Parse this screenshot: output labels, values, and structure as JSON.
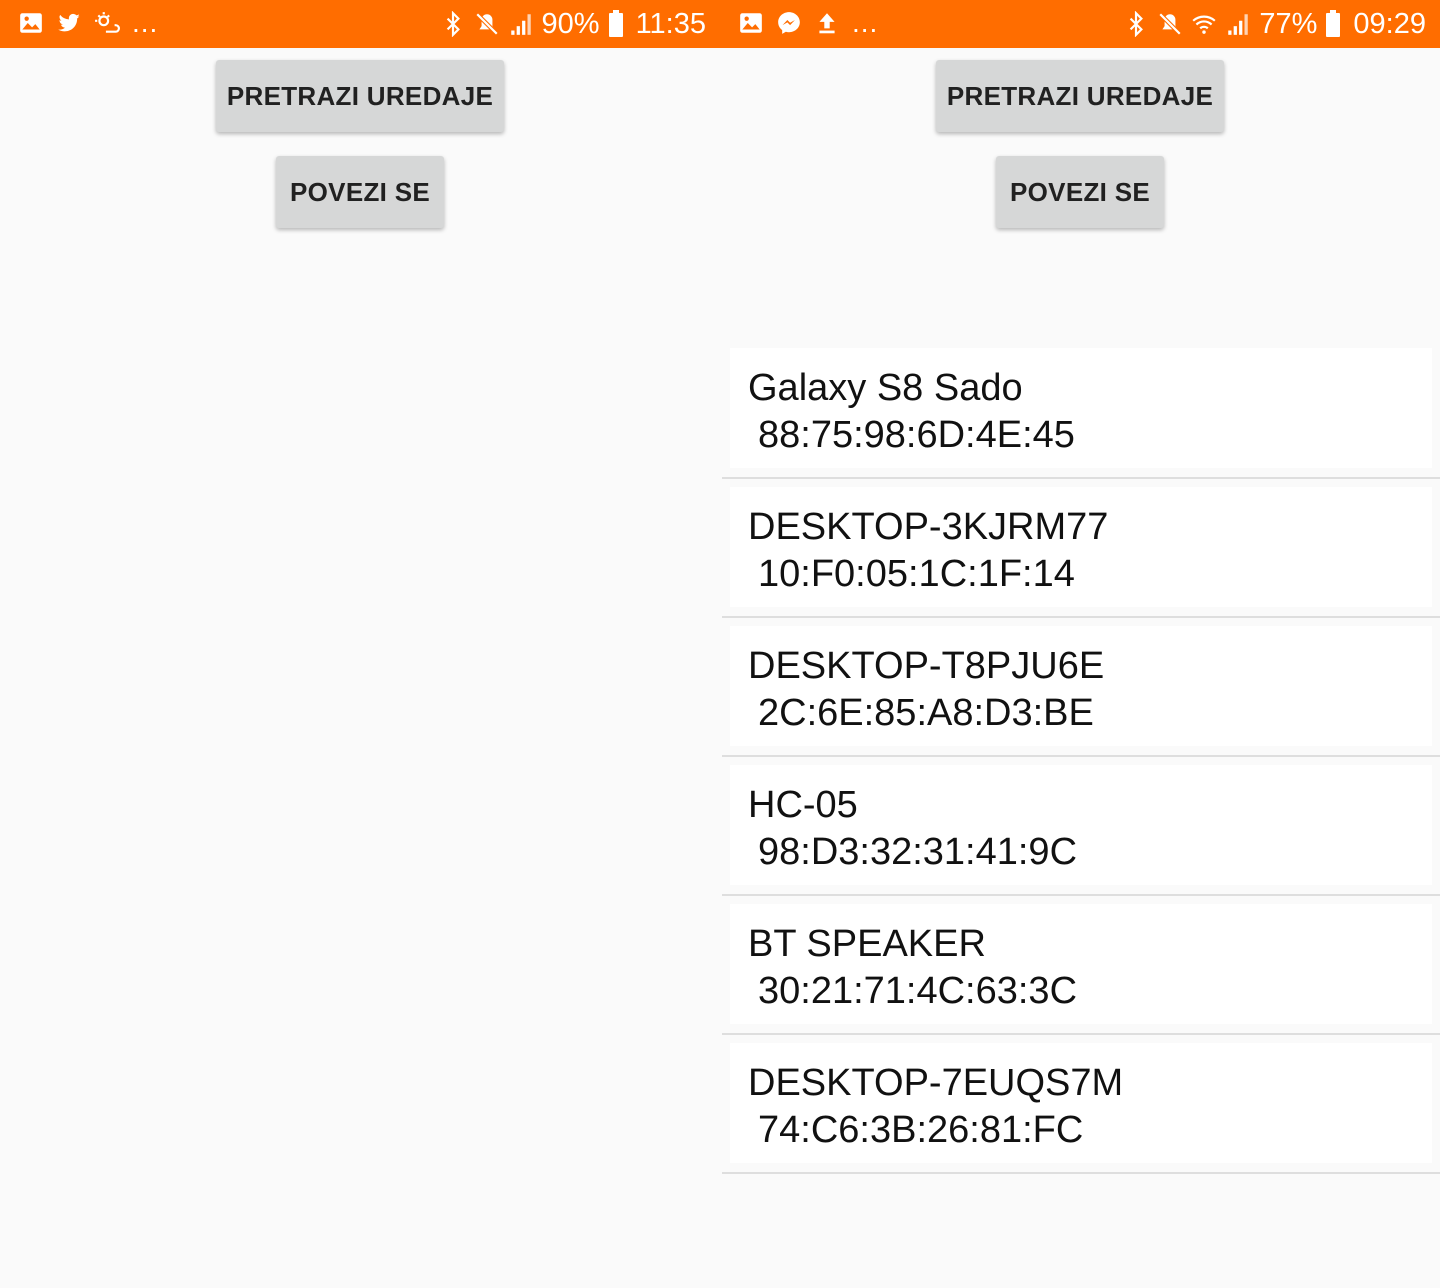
{
  "left_screen": {
    "status": {
      "battery": "90%",
      "time": "11:35"
    },
    "scan_button": "PRETRAZI UREDAJE",
    "connect_button": "POVEZI SE"
  },
  "right_screen": {
    "status": {
      "battery": "77%",
      "time": "09:29"
    },
    "scan_button": "PRETRAZI UREDAJE",
    "connect_button": "POVEZI SE",
    "devices": [
      {
        "name": "Galaxy S8 Sado",
        "mac": "88:75:98:6D:4E:45"
      },
      {
        "name": "DESKTOP-3KJRM77",
        "mac": "10:F0:05:1C:1F:14"
      },
      {
        "name": "DESKTOP-T8PJU6E",
        "mac": "2C:6E:85:A8:D3:BE"
      },
      {
        "name": "HC-05",
        "mac": "98:D3:32:31:41:9C"
      },
      {
        "name": "BT SPEAKER",
        "mac": "30:21:71:4C:63:3C"
      },
      {
        "name": "DESKTOP-7EUQS7M",
        "mac": "74:C6:3B:26:81:FC"
      }
    ]
  },
  "colors": {
    "status_bar": "#ff6d00",
    "button": "#d6d7d7",
    "background": "#fafafa"
  },
  "icons": {
    "left": [
      "gallery-icon",
      "twitter-icon",
      "weather-icon",
      "bluetooth-icon",
      "mute-icon",
      "signal-icon",
      "battery-icon"
    ],
    "right": [
      "gallery-icon",
      "messenger-icon",
      "upload-icon",
      "bluetooth-icon",
      "mute-icon",
      "wifi-icon",
      "signal-icon",
      "battery-icon"
    ]
  }
}
